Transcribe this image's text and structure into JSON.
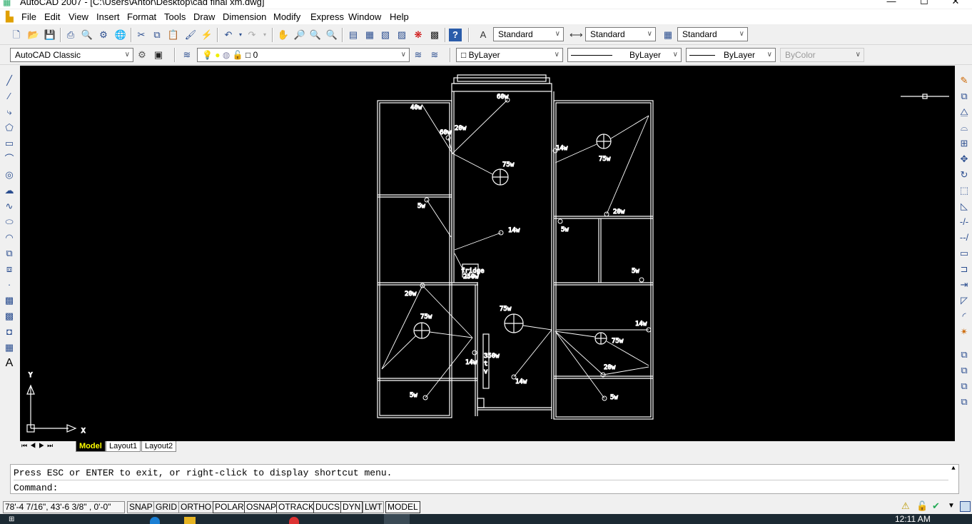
{
  "window": {
    "title": "AutoCAD 2007 - [C:\\Users\\Antor\\Desktop\\cad final xm.dwg]",
    "minimize": "—",
    "maximize": "☐",
    "close": "✕"
  },
  "menu": [
    "File",
    "Edit",
    "View",
    "Insert",
    "Format",
    "Tools",
    "Draw",
    "Dimension",
    "Modify",
    "Express",
    "Window",
    "Help"
  ],
  "styles": {
    "text_style": "Standard",
    "dim_style": "Standard",
    "table_style": "Standard"
  },
  "workspace": "AutoCAD Classic",
  "layer": "0",
  "properties": {
    "color": "ByLayer",
    "linetype": "ByLayer",
    "lineweight": "ByLayer",
    "plotstyle": "ByColor"
  },
  "ucs": {
    "y": "Y",
    "x": "X"
  },
  "drawing_labels": {
    "l60a": "60w",
    "l40": "40w",
    "l60b": "60w",
    "l20a": "20w",
    "l75a": "75w",
    "l14a": "14w",
    "l75b": "75w",
    "l5a": "5w",
    "l14b": "14w",
    "l20b": "20w",
    "l5b": "5w",
    "l5c": "5w",
    "fridge": "fridge",
    "fridge_w": "250w",
    "l20c": "20w",
    "l75c": "75w",
    "l75d": "75w",
    "l14c": "14w",
    "l350": "350w",
    "tv_t": "t",
    "tv_v": "v",
    "l14d": "14w",
    "l14e": "14w",
    "l75e": "75w",
    "l20d": "20w",
    "l5d": "5w",
    "l5e": "5w"
  },
  "layout_tabs": [
    "Model",
    "Layout1",
    "Layout2"
  ],
  "command": {
    "history": "Press ESC or ENTER to exit, or right-click to display shortcut menu.",
    "prompt": "Command:"
  },
  "status": {
    "coords": "78'-4 7/16\",  43'-6 3/8\"  , 0'-0\"",
    "toggles": [
      "SNAP",
      "GRID",
      "ORTHO",
      "POLAR",
      "OSNAP",
      "OTRACK",
      "DUCS",
      "DYN",
      "LWT",
      "MODEL"
    ]
  },
  "clock": "12:11 AM"
}
